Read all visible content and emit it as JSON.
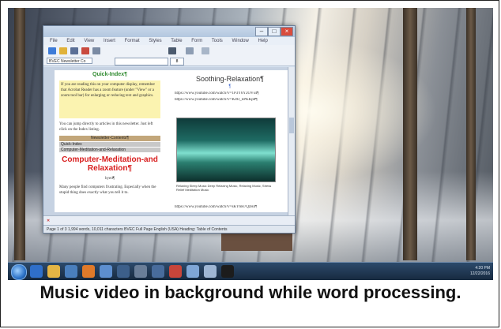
{
  "caption": "Music video in background while word processing.",
  "window": {
    "menus": [
      "File",
      "Edit",
      "View",
      "Insert",
      "Format",
      "Styles",
      "Table",
      "Form",
      "Tools",
      "Window",
      "Help"
    ],
    "style_box": "BVEC Newsletter Co",
    "font_size": "8",
    "status": "Page 1 of 3   1,994 words, 10,011 characters   BVEC Full Page   English (USA)   Heading: Table of Contents"
  },
  "document": {
    "quick_index": "Quick-Index¶",
    "intro_text": "If you are reading this on your computer display, remember that Acrobat Reader has a zoom feature (under \"View\" or a zoom tool bar) for enlarging or reducing text and graphics.",
    "jump_text": "You can jump directly to articles in this newsletter. Just left click on the Index listing.",
    "newsletter_contents": "Newsletter-Contents¶",
    "contents_rows": [
      "Quick-Index",
      "Computer-Meditation-and-Relaxation"
    ],
    "headline": "Computer-Meditation-and Relaxation¶",
    "byline": "byed¶",
    "body_text": "Many people find computers frustrating. Especially when the stupid thing does exactly what you tell it to.",
    "right_title": "Soothing-Relaxation¶",
    "pilcrow": "¶",
    "urls": [
      "https://www.youtube.com/watch?v=1P3Y6Y2OVs4¶",
      "https://www.youtube.com/watch?v=KI9J_nPKKp8¶"
    ],
    "url_bottom": "https://www.youtube.com/watch?v=sKY6H7QzH4¶",
    "video_caption": "Relaxing Sleep Music Deep Relaxing Music, Relaxing Music, Stress Relief Meditation Music"
  },
  "tray": {
    "time": "4:20 PM",
    "date": "12/22/2016"
  }
}
